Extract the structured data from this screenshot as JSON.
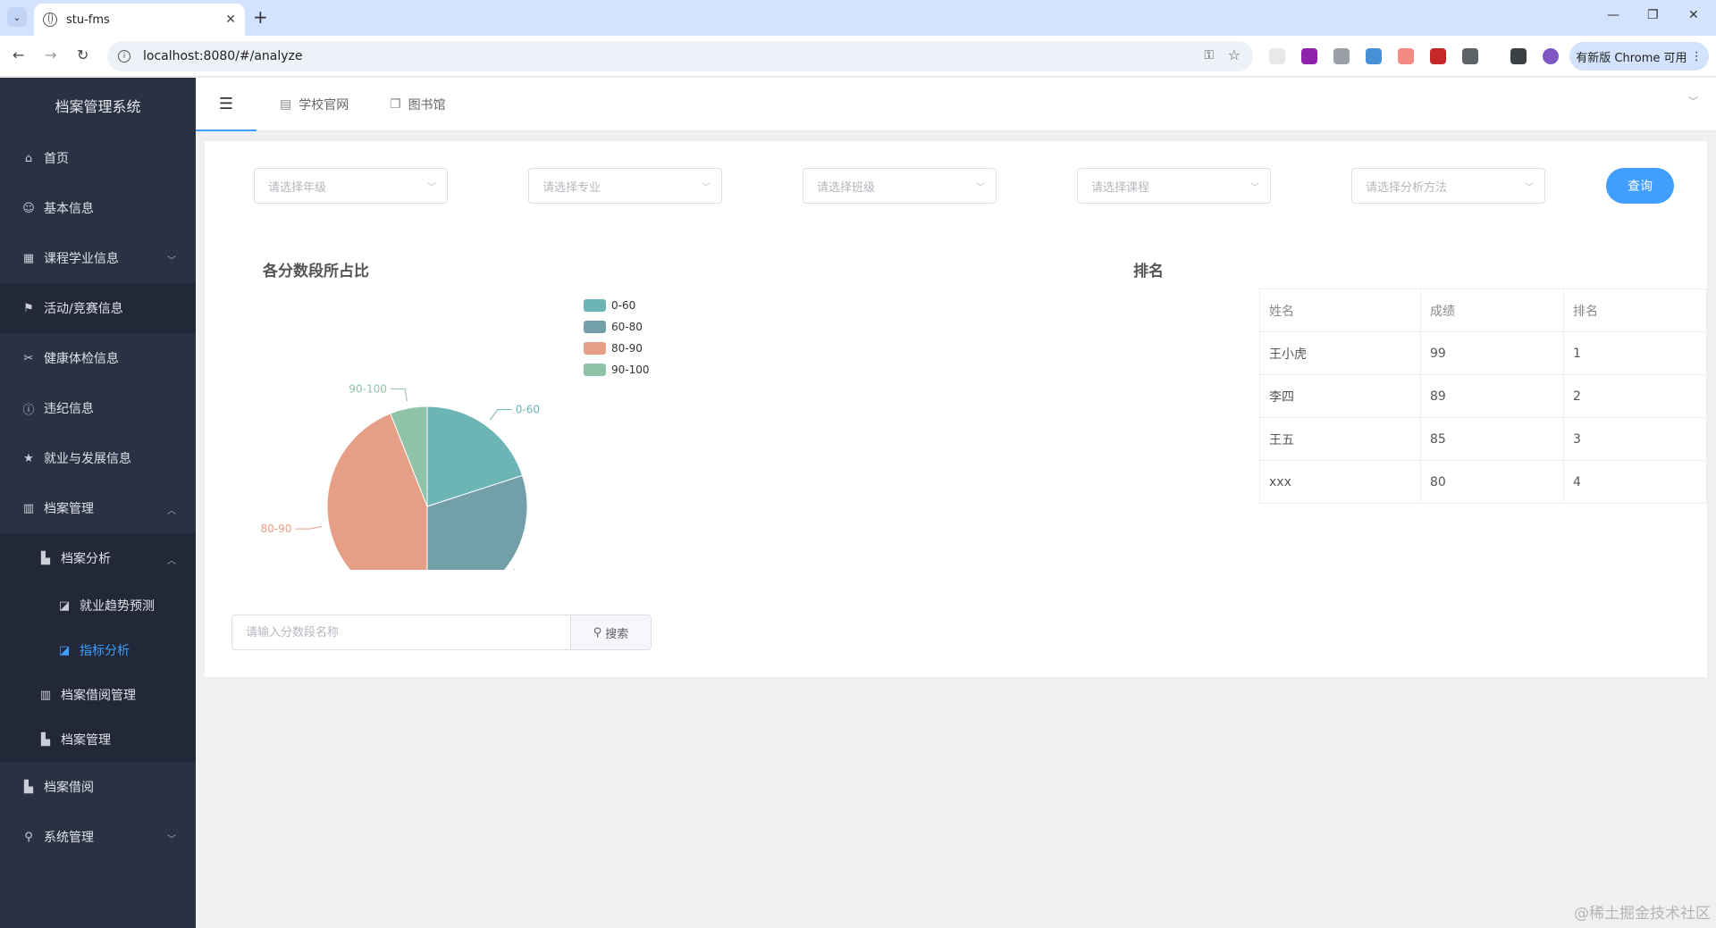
{
  "browser": {
    "tab_title": "stu-fms",
    "url": "localhost:8080/#/analyze",
    "update_label": "有新版 Chrome 可用"
  },
  "sidebar": {
    "brand": "档案管理系统",
    "items": [
      {
        "label": "首页",
        "icon": "home-icon"
      },
      {
        "label": "基本信息",
        "icon": "user-icon"
      },
      {
        "label": "课程学业信息",
        "icon": "grid-icon"
      },
      {
        "label": "活动/竞赛信息",
        "icon": "flag-icon"
      },
      {
        "label": "健康体检信息",
        "icon": "scissors-icon"
      },
      {
        "label": "违纪信息",
        "icon": "info-icon"
      },
      {
        "label": "就业与发展信息",
        "icon": "star-icon"
      },
      {
        "label": "档案管理",
        "icon": "archive-icon"
      },
      {
        "label": "档案分析",
        "icon": "analysis-icon"
      },
      {
        "label": "就业趋势预测",
        "icon": "trend-icon"
      },
      {
        "label": "指标分析",
        "icon": "chart-icon"
      },
      {
        "label": "档案借阅管理",
        "icon": "books-icon"
      },
      {
        "label": "档案管理",
        "icon": "folder-icon"
      },
      {
        "label": "档案借阅",
        "icon": "borrow-icon"
      },
      {
        "label": "系统管理",
        "icon": "location-icon"
      }
    ]
  },
  "header": {
    "links": [
      "学校官网",
      "图书馆"
    ]
  },
  "filters": {
    "grade": "请选择年级",
    "major": "请选择专业",
    "class": "请选择班级",
    "course": "请选择课程",
    "method": "请选择分析方法",
    "query_label": "查询"
  },
  "pie_title": "各分数段所占比",
  "rank_title": "排名",
  "table": {
    "headers": [
      "姓名",
      "成绩",
      "排名"
    ],
    "rows": [
      [
        "王小虎",
        "99",
        "1"
      ],
      [
        "李四",
        "89",
        "2"
      ],
      [
        "王五",
        "85",
        "3"
      ],
      [
        "xxx",
        "80",
        "4"
      ]
    ]
  },
  "search": {
    "placeholder": "请输入分数段名称",
    "button_label": "搜索"
  },
  "watermark": "@稀土掘金技术社区",
  "chart_data": {
    "type": "pie",
    "categories": [
      "0-60",
      "60-80",
      "80-90",
      "90-100"
    ],
    "values": [
      20,
      30,
      44,
      6
    ],
    "colors": [
      "#6db4b5",
      "#73a0a8",
      "#e69e87",
      "#8ec3a8"
    ],
    "legend": "top-right"
  }
}
